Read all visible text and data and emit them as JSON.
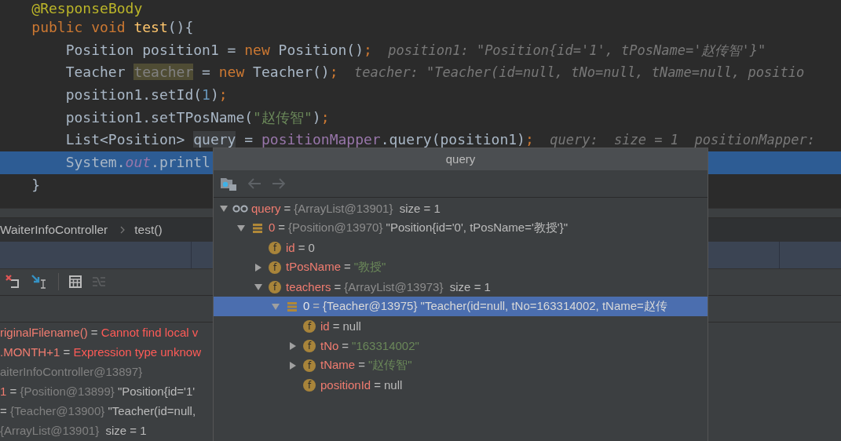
{
  "editor": {
    "lines": [
      {
        "current": false,
        "tokens": [
          {
            "kind": "annotation",
            "text": "@ResponseBody"
          }
        ]
      },
      {
        "current": false,
        "tokens": [
          {
            "kind": "keyword",
            "text": "public void "
          },
          {
            "kind": "method",
            "text": "test"
          },
          {
            "kind": "plain",
            "text": "(){"
          }
        ],
        "children": [
          {
            "current": false,
            "tokens": [
              {
                "kind": "plain",
                "text": "Position position1 = "
              },
              {
                "kind": "keyword",
                "text": "new"
              },
              {
                "kind": "plain",
                "text": " Position()"
              },
              {
                "kind": "keyword",
                "text": ";"
              },
              {
                "kind": "hint",
                "text": "  position1: \"Position{id='1', tPosName='赵传智'}\""
              }
            ]
          },
          {
            "current": false,
            "tokens": [
              {
                "kind": "plain",
                "text": "Teacher "
              },
              {
                "kind": "unused",
                "text": "teacher"
              },
              {
                "kind": "plain",
                "text": " = "
              },
              {
                "kind": "keyword",
                "text": "new"
              },
              {
                "kind": "plain",
                "text": " Teacher()"
              },
              {
                "kind": "keyword",
                "text": ";"
              },
              {
                "kind": "hint",
                "text": "  teacher: \"Teacher(id=null, tNo=null, tName=null, positio"
              }
            ]
          },
          {
            "current": false,
            "tokens": [
              {
                "kind": "plain",
                "text": "position1.setId("
              },
              {
                "kind": "number",
                "text": "1"
              },
              {
                "kind": "plain",
                "text": ")"
              },
              {
                "kind": "keyword",
                "text": ";"
              }
            ]
          },
          {
            "current": false,
            "tokens": [
              {
                "kind": "plain",
                "text": "position1.setTPosName("
              },
              {
                "kind": "string",
                "text": "\"赵传智\""
              },
              {
                "kind": "plain",
                "text": ")"
              },
              {
                "kind": "keyword",
                "text": ";"
              }
            ]
          },
          {
            "current": false,
            "tokens": [
              {
                "kind": "plain",
                "text": "List<Position> "
              },
              {
                "kind": "marked",
                "text": "query"
              },
              {
                "kind": "plain",
                "text": " = "
              },
              {
                "kind": "field",
                "text": "positionMapper"
              },
              {
                "kind": "plain",
                "text": ".query(position1)"
              },
              {
                "kind": "keyword",
                "text": ";"
              },
              {
                "kind": "hint",
                "text": "  query:  size = 1  positionMapper:"
              }
            ]
          },
          {
            "current": true,
            "tokens": [
              {
                "kind": "plain",
                "text": "System."
              },
              {
                "kind": "static",
                "text": "out"
              },
              {
                "kind": "plain",
                "text": ".printl"
              }
            ]
          }
        ]
      },
      {
        "current": false,
        "tokens": [
          {
            "kind": "plain",
            "text": "}"
          }
        ]
      }
    ]
  },
  "breadcrumb": [
    "WaiterInfoController",
    "test()"
  ],
  "variables": [
    {
      "segments": [
        {
          "kind": "name",
          "text": "riginalFilename()"
        },
        {
          "kind": "op",
          "text": " = "
        },
        {
          "kind": "error",
          "text": "Cannot find local v"
        }
      ]
    },
    {
      "segments": [
        {
          "kind": "name",
          "text": ".MONTH+1"
        },
        {
          "kind": "op",
          "text": " = "
        },
        {
          "kind": "error",
          "text": "Expression type unknow"
        }
      ]
    },
    {
      "segments": [
        {
          "kind": "ref",
          "text": "aiterInfoController@13897}"
        }
      ]
    },
    {
      "segments": [
        {
          "kind": "name",
          "text": "1"
        },
        {
          "kind": "op",
          "text": " = "
        },
        {
          "kind": "ref",
          "text": "{Position@13899}"
        },
        {
          "kind": "value",
          "text": " \"Position{id='1'"
        }
      ]
    },
    {
      "segments": [
        {
          "kind": "op",
          "text": "= "
        },
        {
          "kind": "ref",
          "text": "{Teacher@13900}"
        },
        {
          "kind": "value",
          "text": " \"Teacher(id=null,"
        }
      ]
    },
    {
      "segments": [
        {
          "kind": "ref",
          "text": "{ArrayList@13901}"
        },
        {
          "kind": "value",
          "text": "  size = 1"
        }
      ]
    }
  ],
  "popup": {
    "title": "query",
    "tree": [
      {
        "kind": "watch",
        "name": "query",
        "op": "=",
        "ref": "{ArrayList@13901}",
        "value": "  size = 1",
        "expanded": true,
        "selected": false,
        "children": [
          {
            "kind": "element",
            "name": "0",
            "op": "=",
            "ref": "{Position@13970}",
            "value": " \"Position{id='0', tPosName='教授'}\"",
            "expanded": true,
            "selected": false,
            "children": [
              {
                "kind": "field",
                "badge": "f",
                "name": "id",
                "op": "=",
                "value": "0",
                "selected": false
              },
              {
                "kind": "field",
                "badge": "f",
                "name": "tPosName",
                "op": "=",
                "string": "\"教授\"",
                "expanded": false,
                "selected": false
              },
              {
                "kind": "field",
                "badge": "f",
                "name": "teachers",
                "op": "=",
                "ref": "{ArrayList@13973}",
                "value": "  size = 1",
                "expanded": true,
                "selected": false,
                "children": [
                  {
                    "kind": "element",
                    "name": "0",
                    "op": "=",
                    "ref": "{Teacher@13975}",
                    "value": " \"Teacher(id=null, tNo=163314002, tName=赵传",
                    "expanded": true,
                    "selected": true,
                    "children": [
                      {
                        "kind": "field",
                        "badge": "f",
                        "name": "id",
                        "op": "=",
                        "value": "null",
                        "selected": false
                      },
                      {
                        "kind": "field",
                        "badge": "f",
                        "name": "tNo",
                        "op": "=",
                        "string": "\"163314002\"",
                        "expanded": false,
                        "selected": false
                      },
                      {
                        "kind": "field",
                        "badge": "f",
                        "name": "tName",
                        "op": "=",
                        "string": "\"赵传智\"",
                        "expanded": false,
                        "selected": false
                      },
                      {
                        "kind": "field",
                        "badge": "f",
                        "name": "positionId",
                        "op": "=",
                        "value": "null",
                        "selected": false
                      }
                    ]
                  }
                ]
              }
            ]
          }
        ]
      }
    ]
  }
}
